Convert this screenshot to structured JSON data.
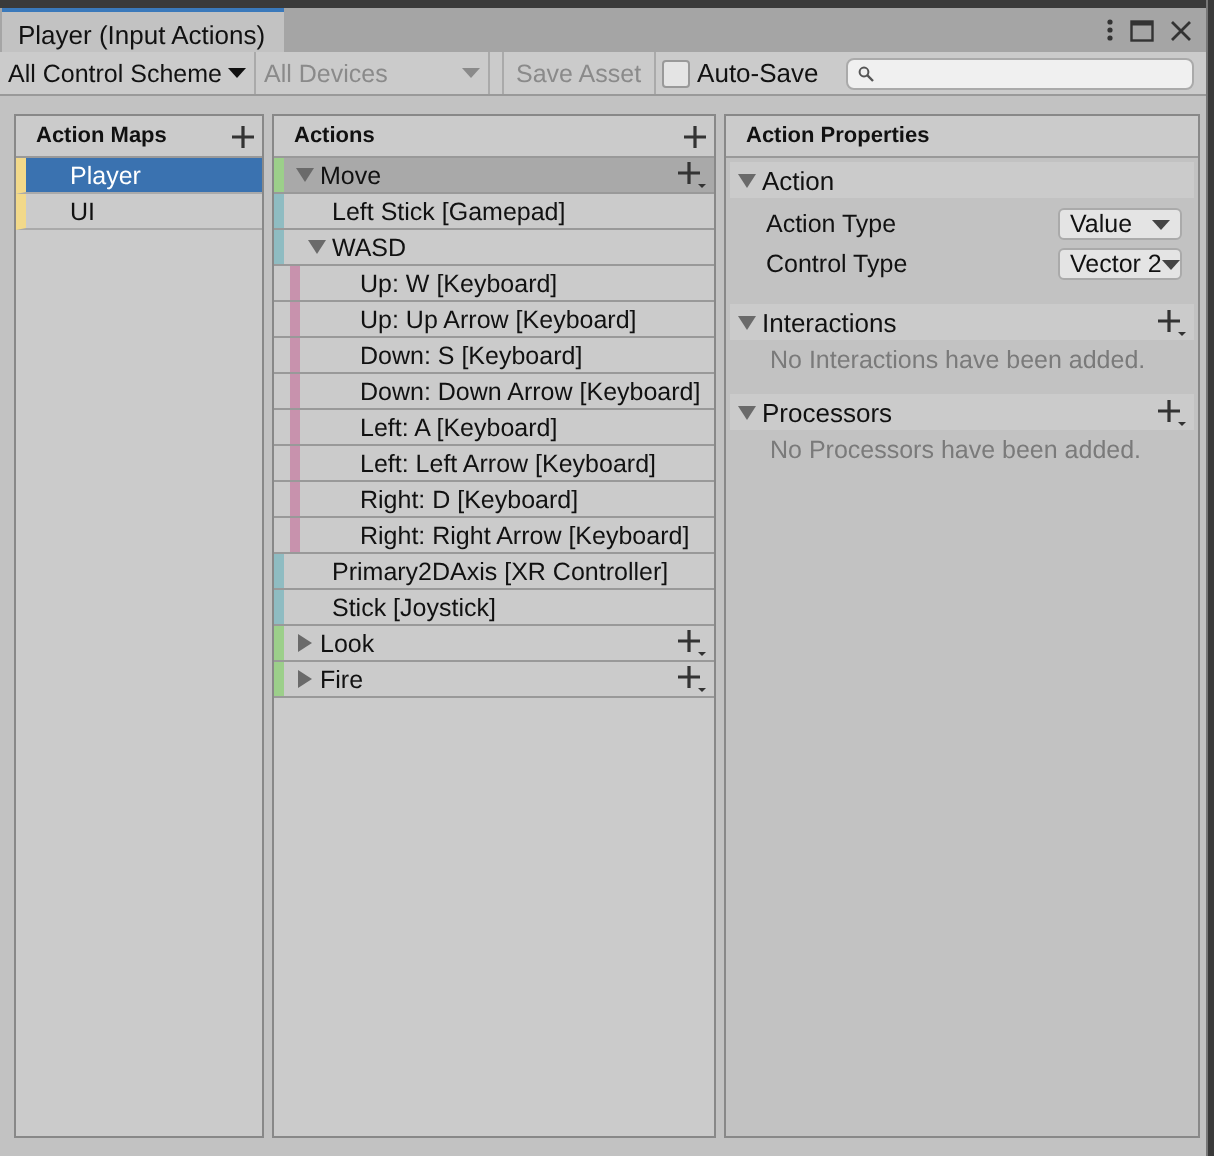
{
  "window": {
    "title": "Player (Input Actions)"
  },
  "toolbar": {
    "control_scheme": {
      "value": "All Control Scheme",
      "disabled": false
    },
    "devices": {
      "value": "All Devices",
      "disabled": true
    },
    "save_button": {
      "label": "Save Asset",
      "disabled": true
    },
    "auto_save": {
      "label": "Auto-Save",
      "checked": false
    }
  },
  "action_maps": {
    "title": "Action Maps",
    "items": [
      {
        "label": "Player",
        "selected": true
      },
      {
        "label": "UI",
        "selected": false
      }
    ]
  },
  "actions": {
    "title": "Actions",
    "items": [
      {
        "kind": "action",
        "label": "Move",
        "expanded": true,
        "selected": true,
        "children": [
          {
            "kind": "binding",
            "label": "Left Stick [Gamepad]",
            "selected": false
          },
          {
            "kind": "composite",
            "label": "WASD",
            "expanded": true,
            "selected": false,
            "children": [
              {
                "kind": "part",
                "label": "Up: W [Keyboard]",
                "selected": false
              },
              {
                "kind": "part",
                "label": "Up: Up Arrow [Keyboard]",
                "selected": false
              },
              {
                "kind": "part",
                "label": "Down: S [Keyboard]",
                "selected": false
              },
              {
                "kind": "part",
                "label": "Down: Down Arrow [Keyboard]",
                "selected": false
              },
              {
                "kind": "part",
                "label": "Left: A [Keyboard]",
                "selected": false
              },
              {
                "kind": "part",
                "label": "Left: Left Arrow [Keyboard]",
                "selected": false
              },
              {
                "kind": "part",
                "label": "Right: D [Keyboard]",
                "selected": false
              },
              {
                "kind": "part",
                "label": "Right: Right Arrow [Keyboard]",
                "selected": false
              }
            ]
          },
          {
            "kind": "binding",
            "label": "Primary2DAxis [XR Controller]",
            "selected": false
          },
          {
            "kind": "binding",
            "label": "Stick [Joystick]",
            "selected": false
          }
        ]
      },
      {
        "kind": "action",
        "label": "Look",
        "expanded": false,
        "selected": false
      },
      {
        "kind": "action",
        "label": "Fire",
        "expanded": false,
        "selected": false
      }
    ]
  },
  "properties": {
    "title": "Action Properties",
    "sections": [
      {
        "title": "Action",
        "expanded": true,
        "fields": [
          {
            "label": "Action Type",
            "value": "Value"
          },
          {
            "label": "Control Type",
            "value": "Vector 2"
          }
        ]
      },
      {
        "title": "Interactions",
        "expanded": true,
        "addable": true,
        "empty_message": "No Interactions have been added."
      },
      {
        "title": "Processors",
        "expanded": true,
        "addable": true,
        "empty_message": "No Processors have been added."
      }
    ]
  }
}
